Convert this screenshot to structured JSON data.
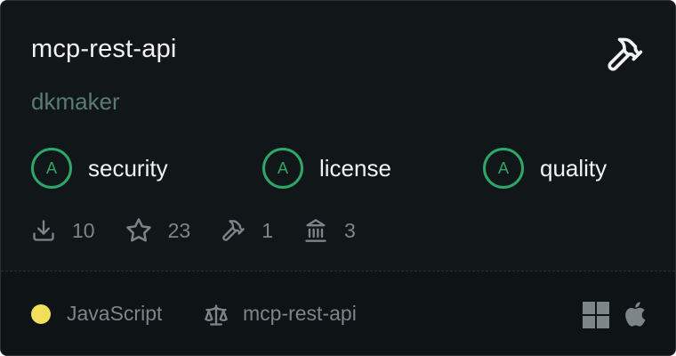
{
  "card": {
    "title": "mcp-rest-api",
    "author": "dkmaker",
    "action_icon": "hammer-icon"
  },
  "scores": [
    {
      "grade": "A",
      "label": "security"
    },
    {
      "grade": "A",
      "label": "license"
    },
    {
      "grade": "A",
      "label": "quality"
    }
  ],
  "stats": {
    "downloads": "10",
    "stars": "23",
    "tools": "1",
    "institutions": "3"
  },
  "footer": {
    "language": "JavaScript",
    "language_color": "#f1de5a",
    "license": "mcp-rest-api",
    "platforms": [
      "windows-icon",
      "apple-icon"
    ]
  },
  "colors": {
    "background": "#111719",
    "grade_green": "#2ea66a",
    "author_green": "#5b7a70"
  }
}
